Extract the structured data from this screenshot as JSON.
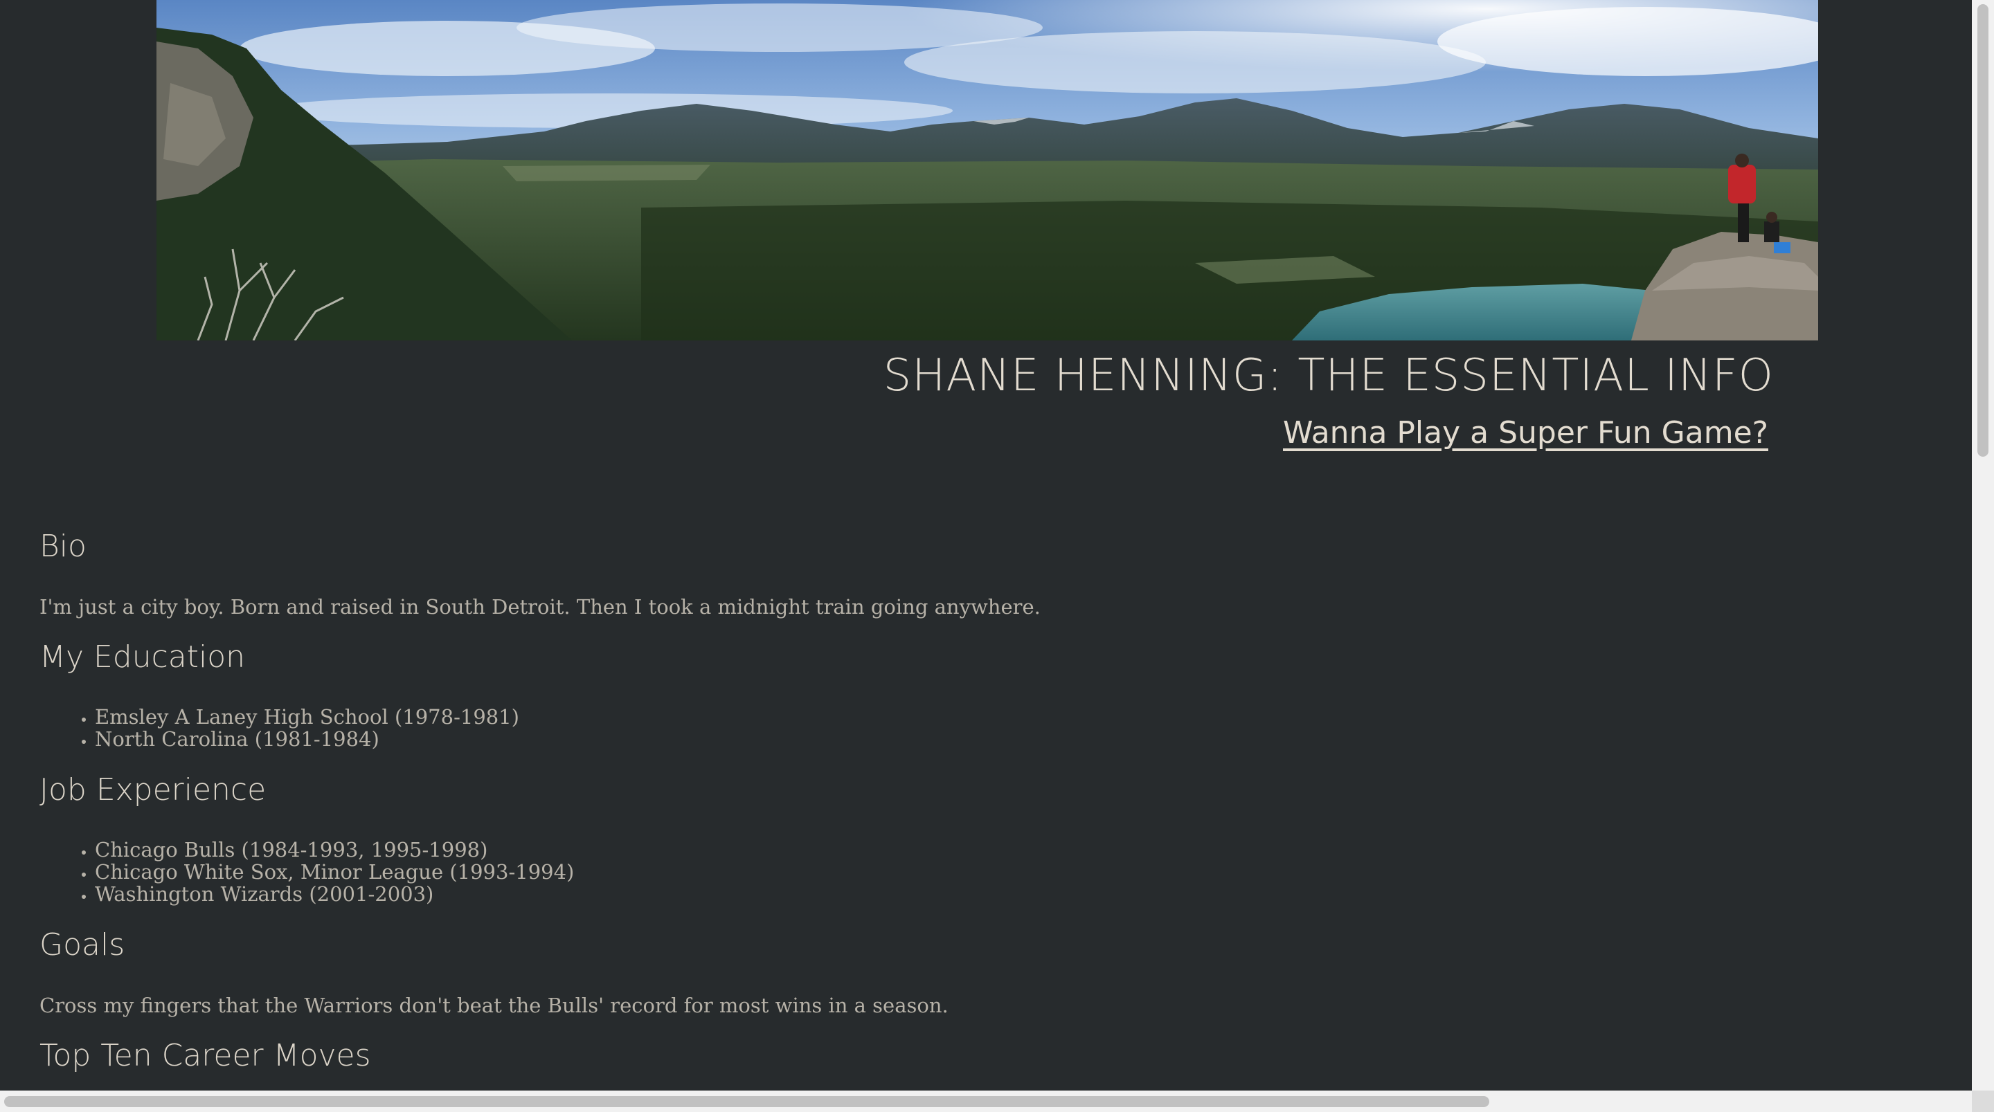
{
  "header": {
    "title": "SHANE HENNING: THE ESSENTIAL INFO",
    "game_link": "Wanna Play a Super Fun Game?"
  },
  "bio": {
    "heading": "Bio",
    "text": "I'm just a city boy. Born and raised in South Detroit. Then I took a midnight train going anywhere."
  },
  "education": {
    "heading": "My Education",
    "items": [
      "Emsley A Laney High School (1978-1981)",
      "North Carolina (1981-1984)"
    ]
  },
  "jobs": {
    "heading": "Job Experience",
    "items": [
      "Chicago Bulls (1984-1993, 1995-1998)",
      "Chicago White Sox, Minor League (1993-1994)",
      "Washington Wizards (2001-2003)"
    ]
  },
  "goals": {
    "heading": "Goals",
    "text": "Cross my fingers that the Warriors don't beat the Bulls' record for most wins in a season."
  },
  "career_moves": {
    "heading": "Top Ten Career Moves"
  },
  "colors": {
    "background": "#272b2d",
    "heading": "#dcd5c9",
    "body_text": "#b7b2a8",
    "title": "#e3dcd0"
  }
}
